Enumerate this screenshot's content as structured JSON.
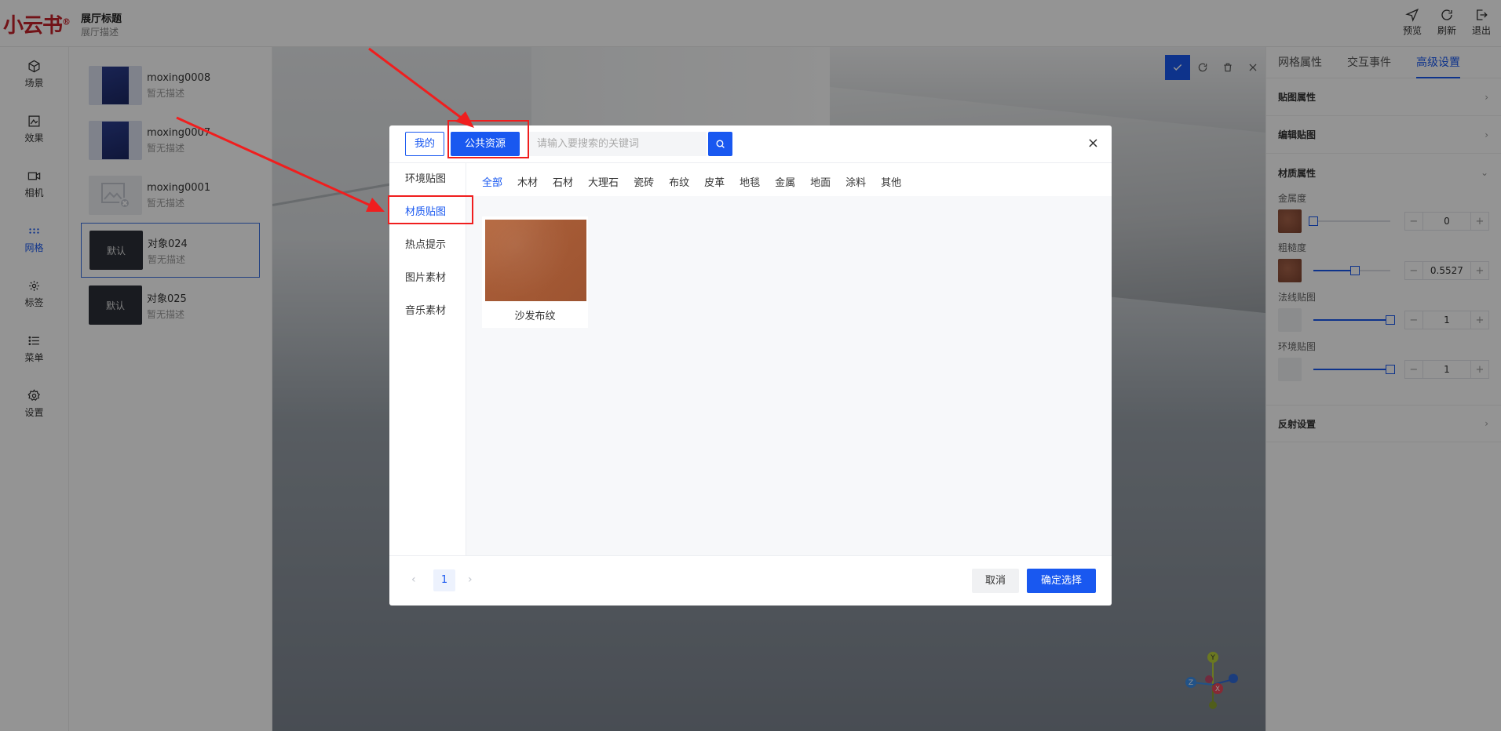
{
  "header": {
    "logo": "小云书",
    "logo_mark": "®",
    "title": "展厅标题",
    "description": "展厅描述",
    "actions": [
      {
        "label": "预览",
        "icon": "send-icon"
      },
      {
        "label": "刷新",
        "icon": "refresh-icon"
      },
      {
        "label": "退出",
        "icon": "logout-icon"
      }
    ]
  },
  "nav": {
    "items": [
      {
        "label": "场景",
        "icon": "cube-icon"
      },
      {
        "label": "效果",
        "icon": "image-effect-icon"
      },
      {
        "label": "相机",
        "icon": "camera-icon"
      },
      {
        "label": "网格",
        "icon": "grid-dots-icon",
        "active": true
      },
      {
        "label": "标签",
        "icon": "tag-icon"
      },
      {
        "label": "菜单",
        "icon": "menu-icon"
      },
      {
        "label": "设置",
        "icon": "gear-icon"
      }
    ]
  },
  "objects": [
    {
      "name": "moxing0008",
      "desc": "暂无描述",
      "thumb": "book"
    },
    {
      "name": "moxing0007",
      "desc": "暂无描述",
      "thumb": "book"
    },
    {
      "name": "moxing0001",
      "desc": "暂无描述",
      "thumb": "placeholder"
    },
    {
      "name": "对象024",
      "desc": "暂无描述",
      "thumb": "dark",
      "thumb_text": "默认",
      "selected": true
    },
    {
      "name": "对象025",
      "desc": "暂无描述",
      "thumb": "dark",
      "thumb_text": "默认"
    }
  ],
  "right_panel": {
    "tabs": [
      "网格属性",
      "交互事件",
      "高级设置"
    ],
    "active_tab": 2,
    "sections": {
      "texture_props": "贴图属性",
      "edit_texture": "编辑贴图",
      "material_props": "材质属性",
      "reflection": "反射设置"
    },
    "props": [
      {
        "label": "金属度",
        "value": "0",
        "fraction": 0.0,
        "swatch": "leather"
      },
      {
        "label": "粗糙度",
        "value": "0.5527",
        "fraction": 0.55,
        "swatch": "leather"
      },
      {
        "label": "法线贴图",
        "value": "1",
        "fraction": 1.0,
        "swatch": "empty"
      },
      {
        "label": "环境贴图",
        "value": "1",
        "fraction": 1.0,
        "swatch": "empty"
      }
    ]
  },
  "modal": {
    "tab_mine": "我的",
    "tab_public": "公共资源",
    "search_placeholder": "请输入要搜索的关键词",
    "close": "×",
    "sidebar": [
      "环境贴图",
      "材质贴图",
      "热点提示",
      "图片素材",
      "音乐素材"
    ],
    "sidebar_active": 1,
    "categories": [
      "全部",
      "木材",
      "石材",
      "大理石",
      "瓷砖",
      "布纹",
      "皮革",
      "地毯",
      "金属",
      "地面",
      "涂料",
      "其他"
    ],
    "category_active": 0,
    "items": [
      {
        "label": "沙发布纹",
        "color": "#a85d37"
      }
    ],
    "pagination": {
      "prev": "‹",
      "current": "1",
      "next": "›"
    },
    "cancel": "取消",
    "confirm": "确定选择"
  },
  "colors": {
    "accent": "#1958f0",
    "annotation": "#f01e1e",
    "logo": "#c5222a"
  }
}
